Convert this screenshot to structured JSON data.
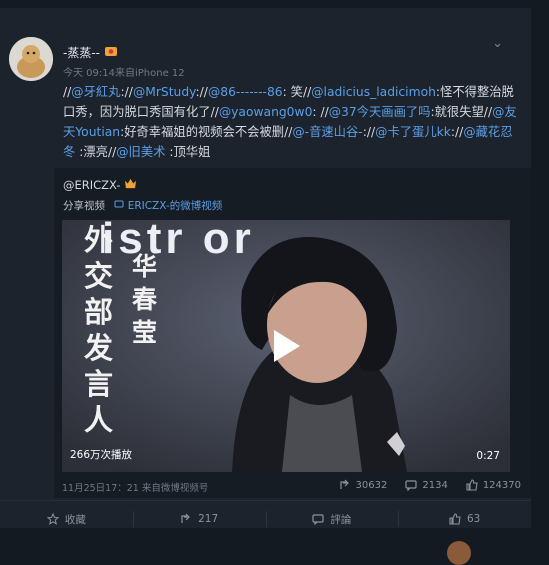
{
  "post": {
    "username": "-蒸蒸--",
    "meta": "今天 09:14来自iPhone 12",
    "segments": [
      {
        "t": "//",
        "m": false
      },
      {
        "t": "@牙紅丸",
        "m": true
      },
      {
        "t": "://",
        "m": false
      },
      {
        "t": "@MrStudy",
        "m": true
      },
      {
        "t": "://",
        "m": false
      },
      {
        "t": "@86-------86",
        "m": true
      },
      {
        "t": ": 笑//",
        "m": false
      },
      {
        "t": "@ladicius_ladicimoh",
        "m": true
      },
      {
        "t": ":怪不得整治脱口秀，因为脱口秀国有化了//",
        "m": false
      },
      {
        "t": "@yaowang0w0",
        "m": true
      },
      {
        "t": ": //",
        "m": false
      },
      {
        "t": "@37今天画画了吗",
        "m": true
      },
      {
        "t": ":就很失望//",
        "m": false
      },
      {
        "t": "@友天Youtian",
        "m": true
      },
      {
        "t": ":好奇幸福姐的视频会不会被删//",
        "m": false
      },
      {
        "t": "@-音速山谷-",
        "m": true
      },
      {
        "t": "://",
        "m": false
      },
      {
        "t": "@卡了蛋儿kk",
        "m": true
      },
      {
        "t": "://",
        "m": false
      },
      {
        "t": "@藏花忍冬",
        "m": true
      },
      {
        "t": " :漂亮//",
        "m": false
      },
      {
        "t": "@旧美术",
        "m": true
      },
      {
        "t": " :顶华姐",
        "m": false
      }
    ]
  },
  "quote": {
    "user": "@ERICZX-",
    "share_label": "分享视频",
    "link_text": "ERICZX-的微博视频",
    "views": "266万次播放",
    "duration": "0:27",
    "date": "11月25日17：21 来自微博视频号",
    "shares": "30632",
    "comments": "2134",
    "likes": "124370"
  },
  "video_overlay": {
    "title_text": "外交部发言人",
    "name_text": "华春莹",
    "backdrop_text": "istr or"
  },
  "actions": {
    "favorite": "收藏",
    "repost": "217",
    "comment": "評論",
    "like": "63"
  },
  "colors": {
    "mention": "#5c9fe6",
    "card_bg": "#1c232d"
  },
  "icons": [
    "chevron-down-icon",
    "share-icon",
    "comment-icon",
    "like-icon",
    "star-icon",
    "link-icon",
    "play-icon"
  ]
}
